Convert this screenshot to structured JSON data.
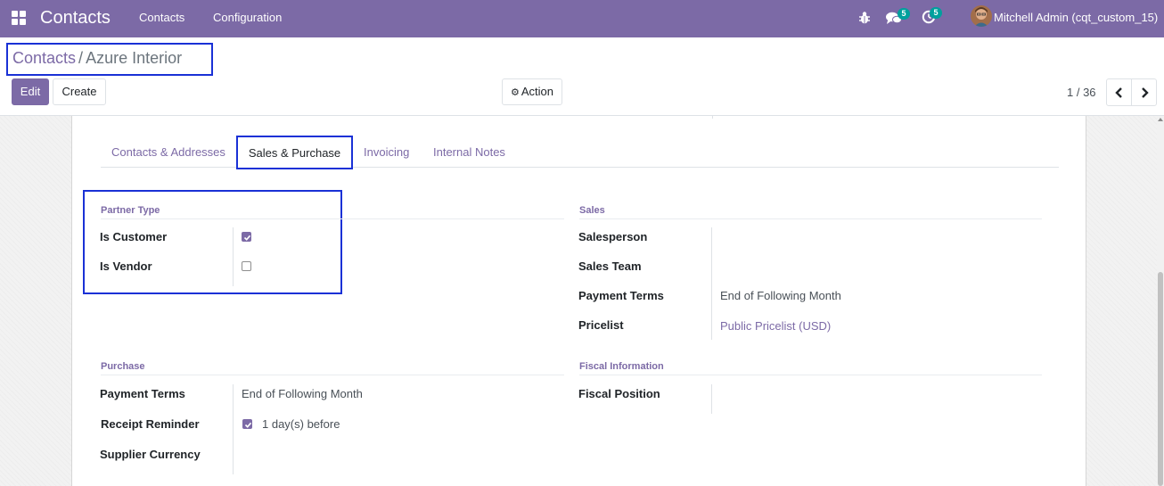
{
  "navbar": {
    "app_title": "Contacts",
    "menu": [
      "Contacts",
      "Configuration"
    ],
    "messages_badge": "5",
    "activities_badge": "5",
    "user": "Mitchell Admin (cqt_custom_15)",
    "icons": [
      "apps-grid-icon",
      "bug-icon",
      "chat-icon",
      "activity-clock-icon",
      "avatar"
    ]
  },
  "breadcrumb": {
    "parent": "Contacts",
    "separator": "/",
    "current": "Azure Interior"
  },
  "toolbar": {
    "edit": "Edit",
    "create": "Create",
    "action": "Action",
    "pager": "1 / 36"
  },
  "tabs": [
    "Contacts & Addresses",
    "Sales & Purchase",
    "Invoicing",
    "Internal Notes"
  ],
  "active_tab": "Sales & Purchase",
  "partner_type": {
    "title": "Partner Type",
    "is_customer_label": "Is Customer",
    "is_customer": true,
    "is_vendor_label": "Is Vendor",
    "is_vendor": false
  },
  "sales": {
    "title": "Sales",
    "salesperson_label": "Salesperson",
    "salesperson": "",
    "sales_team_label": "Sales Team",
    "sales_team": "",
    "payment_terms_label": "Payment Terms",
    "payment_terms": "End of Following Month",
    "pricelist_label": "Pricelist",
    "pricelist": "Public Pricelist (USD)"
  },
  "purchase": {
    "title": "Purchase",
    "payment_terms_label": "Payment Terms",
    "payment_terms": "End of Following Month",
    "receipt_reminder_label": "Receipt Reminder",
    "receipt_reminder": true,
    "receipt_reminder_text": "1 day(s) before",
    "supplier_currency_label": "Supplier Currency",
    "supplier_currency": ""
  },
  "fiscal": {
    "title": "Fiscal Information",
    "fiscal_position_label": "Fiscal Position",
    "fiscal_position": ""
  },
  "colors": {
    "brand": "#7c6aa6",
    "badge": "#00a09d",
    "highlight": "#1a31d6"
  }
}
